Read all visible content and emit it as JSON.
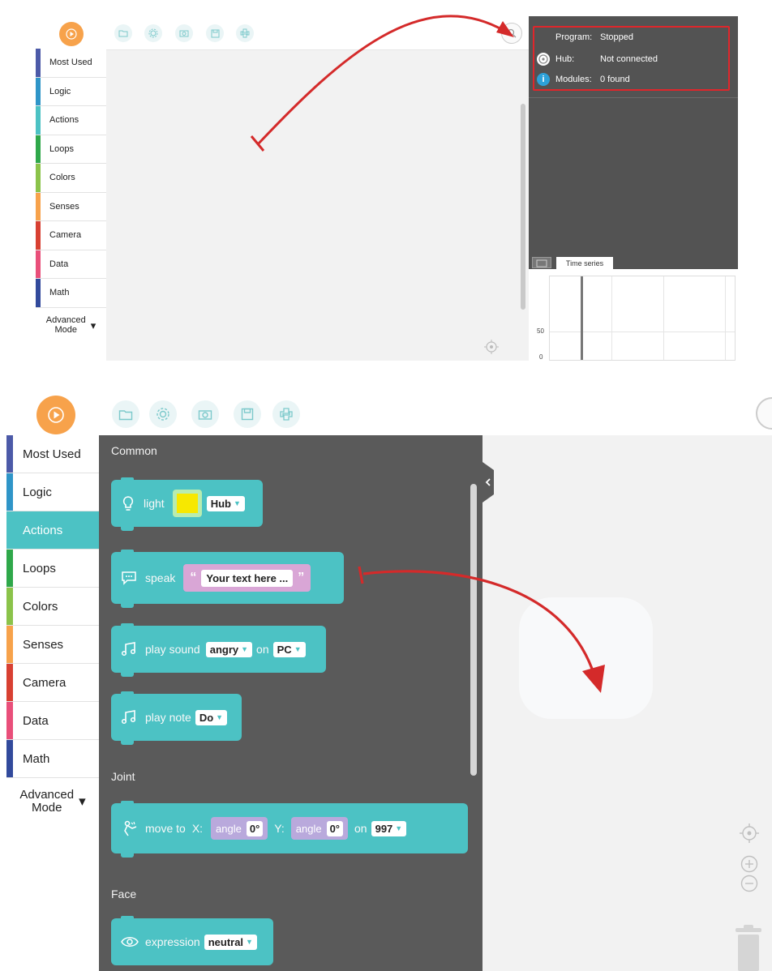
{
  "colors": {
    "accent_orange": "#f7a24b",
    "block_teal": "#4cc2c4",
    "flyout_bg": "#5a5a5a",
    "status_bg": "#535353",
    "highlight_red": "#e0262b",
    "canvas_bg": "#f2f2f2"
  },
  "toolbar": {
    "icons": [
      "folder-icon",
      "gear-icon",
      "camera-icon",
      "save-icon",
      "python-icon"
    ]
  },
  "sidebar": {
    "items": [
      {
        "label": "Most Used",
        "color": "#4c5aa8"
      },
      {
        "label": "Logic",
        "color": "#2f95c8"
      },
      {
        "label": "Actions",
        "color": "#4cc2c4"
      },
      {
        "label": "Loops",
        "color": "#2fa84a"
      },
      {
        "label": "Colors",
        "color": "#8bc34a"
      },
      {
        "label": "Senses",
        "color": "#f7a24b"
      },
      {
        "label": "Camera",
        "color": "#d84032"
      },
      {
        "label": "Data",
        "color": "#e94f7a"
      },
      {
        "label": "Math",
        "color": "#324a9c"
      }
    ],
    "advanced_line1": "Advanced",
    "advanced_line2": "Mode",
    "active_bottom": "Actions"
  },
  "status": {
    "program_label": "Program:",
    "program_value": "Stopped",
    "hub_label": "Hub:",
    "hub_value": "Not connected",
    "modules_label": "Modules:",
    "modules_value": "0 found"
  },
  "timeseries": {
    "tab_label": "Time series",
    "y_tick_50": "50",
    "y_tick_0": "0"
  },
  "flyout": {
    "cat_common": "Common",
    "cat_joint": "Joint",
    "cat_face": "Face",
    "light": {
      "label": "light",
      "target": "Hub"
    },
    "speak": {
      "label": "speak",
      "text": "Your text here ..."
    },
    "play_sound": {
      "label": "play sound",
      "sound": "angry",
      "on_label": "on",
      "target": "PC"
    },
    "play_note": {
      "label": "play note",
      "note": "Do"
    },
    "move_to": {
      "label": "move to",
      "x_label": "X:",
      "angle_label": "angle",
      "x_value": "0°",
      "y_label": "Y:",
      "y_value": "0°",
      "on_label": "on",
      "target": "997"
    },
    "expression": {
      "label": "expression",
      "value": "neutral"
    }
  }
}
